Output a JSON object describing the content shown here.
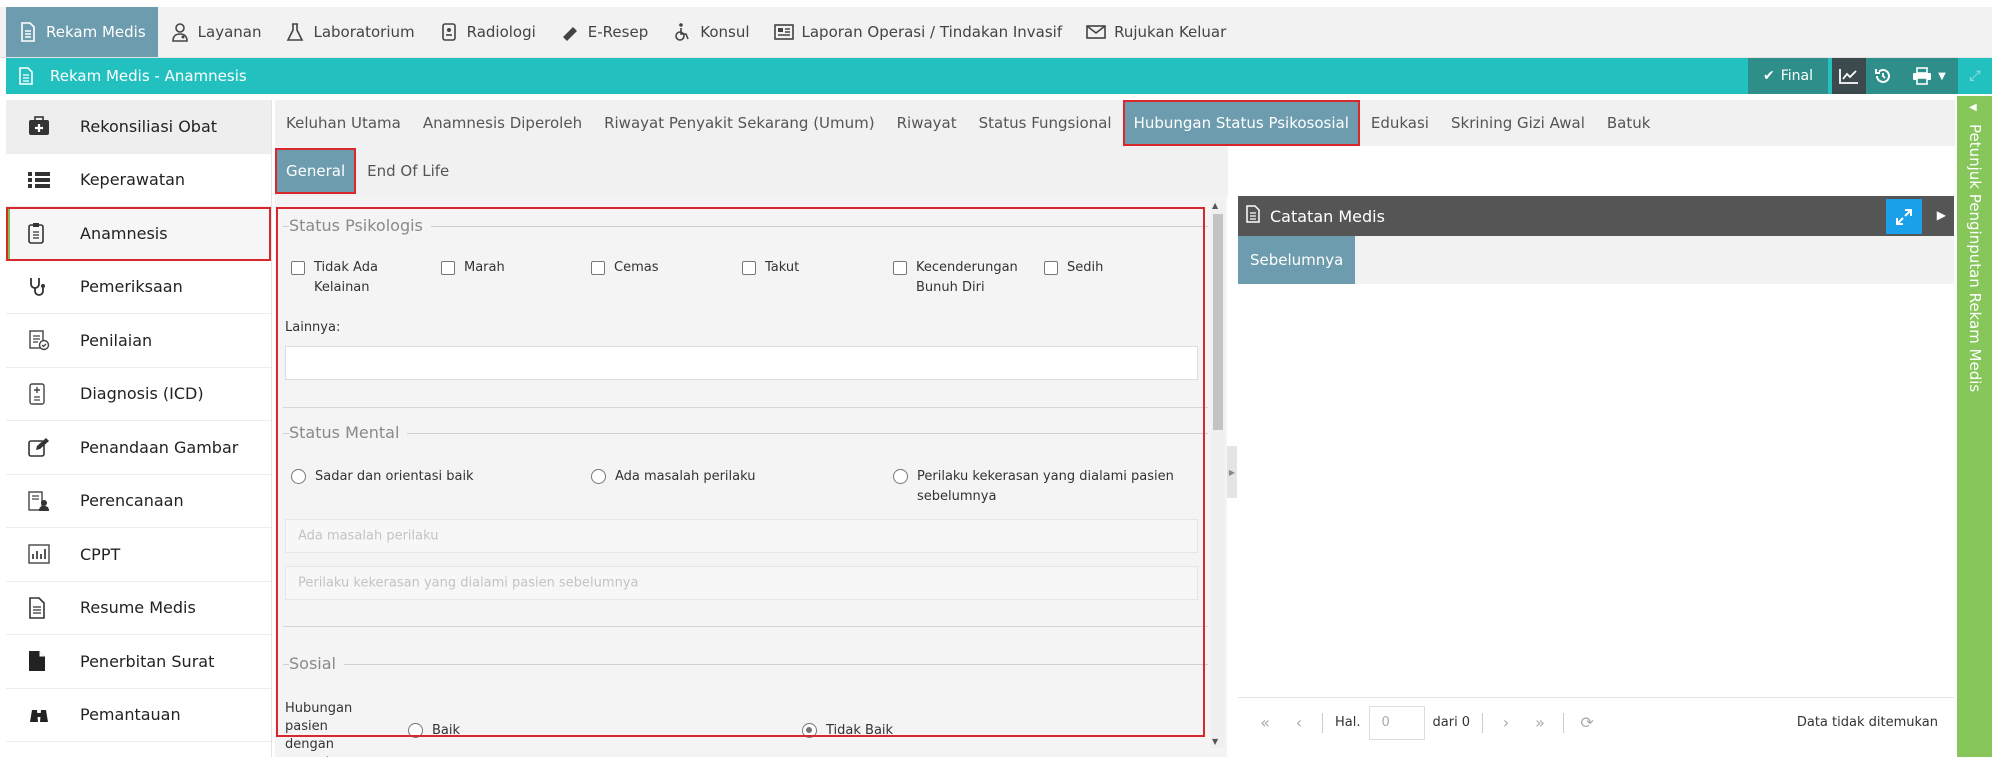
{
  "topnav": {
    "items": [
      {
        "label": "Rekam Medis",
        "icon": "document-icon",
        "active": true
      },
      {
        "label": "Layanan",
        "icon": "user-doctor-icon"
      },
      {
        "label": "Laboratorium",
        "icon": "flask-icon"
      },
      {
        "label": "Radiologi",
        "icon": "radiology-icon"
      },
      {
        "label": "E-Resep",
        "icon": "pill-icon"
      },
      {
        "label": "Konsul",
        "icon": "wheelchair-icon"
      },
      {
        "label": "Laporan Operasi / Tindakan Invasif",
        "icon": "newspaper-icon"
      },
      {
        "label": "Rujukan Keluar",
        "icon": "envelope-icon"
      }
    ]
  },
  "titlebar": {
    "title": "Rekam Medis - Anamnesis",
    "final_label": "Final"
  },
  "sidebar": {
    "items": [
      {
        "label": "Rekonsiliasi Obat",
        "icon": "medkit-icon"
      },
      {
        "label": "Keperawatan",
        "icon": "list-icon"
      },
      {
        "label": "Anamnesis",
        "icon": "clipboard-icon",
        "active": true
      },
      {
        "label": "Pemeriksaan",
        "icon": "stethoscope-icon"
      },
      {
        "label": "Penilaian",
        "icon": "assessment-icon"
      },
      {
        "label": "Diagnosis (ICD)",
        "icon": "diagnosis-icon"
      },
      {
        "label": "Penandaan Gambar",
        "icon": "edit-icon"
      },
      {
        "label": "Perencanaan",
        "icon": "planning-icon"
      },
      {
        "label": "CPPT",
        "icon": "chart-icon"
      },
      {
        "label": "Resume Medis",
        "icon": "file-text-icon"
      },
      {
        "label": "Penerbitan Surat",
        "icon": "file-icon"
      },
      {
        "label": "Pemantauan",
        "icon": "binoculars-icon"
      }
    ]
  },
  "tabs": {
    "row1": [
      "Keluhan Utama",
      "Anamnesis Diperoleh",
      "Riwayat Penyakit Sekarang (Umum)",
      "Riwayat",
      "Status Fungsional",
      "Hubungan Status Psikososial",
      "Edukasi",
      "Skrining Gizi Awal",
      "Batuk"
    ],
    "row1_active": "Hubungan Status Psikososial",
    "row2": [
      "General",
      "End Of Life"
    ],
    "row2_active": "General"
  },
  "form": {
    "psikologis": {
      "title": "Status Psikologis",
      "options": [
        "Tidak Ada Kelainan",
        "Marah",
        "Cemas",
        "Takut",
        "Kecenderungan Bunuh Diri",
        "Sedih"
      ],
      "lainnya_label": "Lainnya:",
      "lainnya_value": ""
    },
    "mental": {
      "title": "Status Mental",
      "options": [
        "Sadar dan orientasi baik",
        "Ada masalah perilaku",
        "Perilaku kekerasan yang dialami pasien sebelumnya"
      ],
      "placeholder_1": "Ada masalah perilaku",
      "placeholder_2": "Perilaku kekerasan yang dialami pasien sebelumnya"
    },
    "sosial": {
      "title": "Sosial",
      "label": "Hubungan pasien dengan anggota",
      "options": [
        "Baik",
        "Tidak Baik"
      ],
      "selected": "Tidak Baik"
    }
  },
  "right_panel": {
    "title": "Catatan Medis",
    "tab": "Sebelumnya",
    "pager": {
      "hal_label": "Hal.",
      "page_value": "0",
      "of_label": "dari 0",
      "status": "Data tidak ditemukan"
    }
  },
  "side_strip": {
    "label": "Petunjuk Penginputan Rekam Medis"
  },
  "colors": {
    "accent_teal": "#22c1c0",
    "active_tab": "#6c9cad",
    "highlight_red": "#d9272e",
    "strip_green": "#86c65a"
  }
}
